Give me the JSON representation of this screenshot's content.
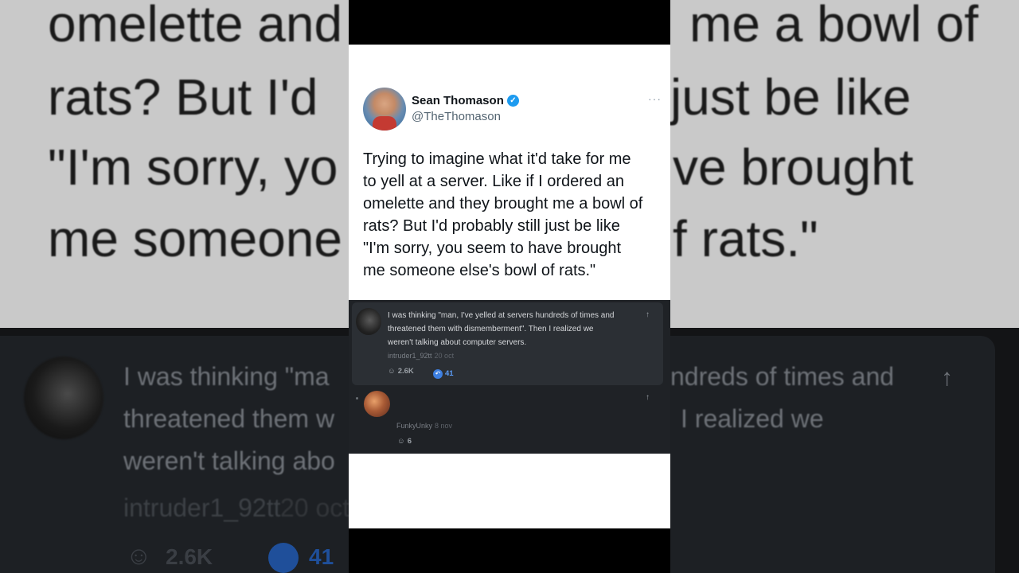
{
  "background": {
    "top_lines": [
      "omelette and",
      "me a bowl of",
      "rats? But I'd",
      "just be like",
      "\"I'm sorry, yo",
      "ve brought",
      "me someone",
      "f rats.\""
    ],
    "bottom_lines": [
      "I was thinking \"ma",
      "ndreds of times and",
      "threatened them w",
      "I realized we",
      "weren't talking abo"
    ],
    "meta_user": "intruder1_92tt",
    "meta_date": "20 oct",
    "react_count": "2.6K",
    "reply_count": "41"
  },
  "tweet": {
    "display_name": "Sean Thomason",
    "handle": "@TheThomason",
    "more_label": "···",
    "verified_mark": "✓",
    "lines": [
      "Trying to imagine what it'd take for me",
      "to yell at a server. Like if I ordered an",
      "omelette and they brought me a bowl of",
      "rats? But I'd probably still just be like",
      "\"I'm sorry, you seem to have brought",
      "me someone else's bowl of rats.\""
    ]
  },
  "screenshot": {
    "reply1": {
      "lines": [
        "I was thinking \"man, I've yelled at servers hundreds of times and",
        "threatened them with dismemberment\". Then I realized we",
        "weren't talking about computer servers."
      ],
      "username": "intruder1_92tt",
      "date": "20 oct",
      "react_count": "2.6K",
      "reply_count": "41"
    },
    "reply2": {
      "username": "FunkyUnky",
      "date": "8 nov",
      "react_count": "6"
    },
    "share_glyph": "↑",
    "react_glyph": "☺",
    "reply_glyph": "↶"
  },
  "colors": {
    "verified": "#1d9bf0",
    "reply_blue": "#3d7fe0"
  }
}
